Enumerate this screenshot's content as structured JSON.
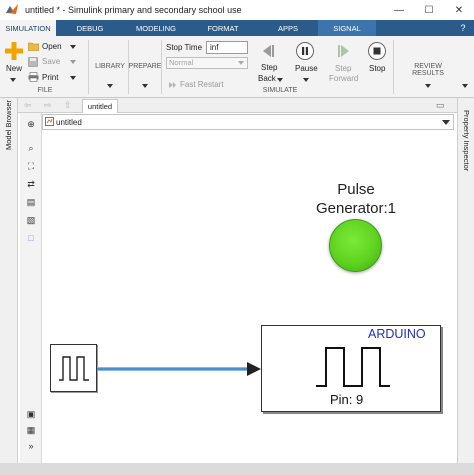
{
  "window": {
    "title": "untitled * - Simulink primary and secondary school use",
    "minimize": "—",
    "maximize": "☐",
    "close": "✕"
  },
  "ribbon_tabs": [
    "SIMULATION",
    "DEBUG",
    "MODELING",
    "FORMAT",
    "APPS",
    "SIGNAL"
  ],
  "file_group": {
    "label": "FILE",
    "new": "New",
    "open": "Open",
    "save": "Save",
    "print": "Print"
  },
  "library_label": "LIBRARY",
  "prepare_label": "PREPARE",
  "simulate_group": {
    "label": "SIMULATE",
    "stop_time_label": "Stop Time",
    "stop_time_value": "inf",
    "mode": "Normal",
    "fast_restart": "Fast Restart",
    "step_back": [
      "Step",
      "Back"
    ],
    "pause": "Pause",
    "step_forward": [
      "Step",
      "Forward"
    ],
    "stop": "Stop"
  },
  "review_results_label": "REVIEW RESULTS",
  "document_tab": "untitled",
  "address": "untitled",
  "model_browser_label": "Model Browser",
  "property_inspector_label": "Property Inspector",
  "blocks": {
    "pulse_generator_name": [
      "Pulse",
      "Generator:1"
    ],
    "arduino_title": "ARDUINO",
    "arduino_pin": "Pin: 9"
  },
  "colors": {
    "ribbon_tab_bar": "#2a5b8a",
    "led_green": "#5fd31f",
    "signal_line": "#3a7fc0",
    "arduino_text": "#1f2fb8"
  }
}
